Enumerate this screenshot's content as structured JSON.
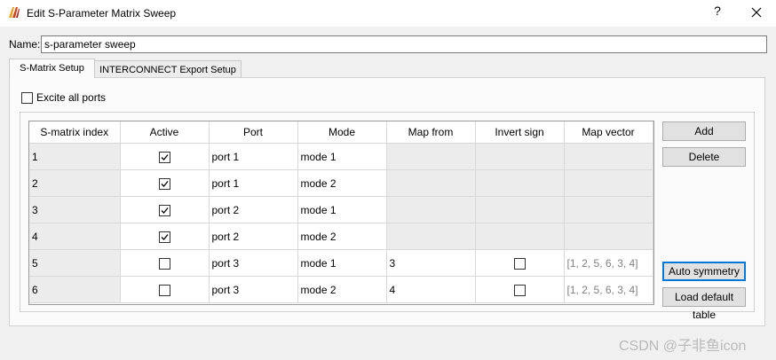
{
  "window": {
    "title": "Edit S-Parameter Matrix Sweep",
    "help_label": "?",
    "app_icon": "lumerical-logo-icon",
    "close_icon": "close-icon"
  },
  "name_field": {
    "label": "Name:",
    "value": "s-parameter sweep"
  },
  "tabs": [
    {
      "label": "S-Matrix Setup",
      "active": true
    },
    {
      "label": "INTERCONNECT Export Setup",
      "active": false
    }
  ],
  "excite_all_ports": {
    "label": "Excite all ports",
    "checked": false
  },
  "table": {
    "columns": [
      "S-matrix index",
      "Active",
      "Port",
      "Mode",
      "Map from",
      "Invert sign",
      "Map vector"
    ],
    "rows": [
      {
        "index": "1",
        "active": true,
        "port": "port 1",
        "mode": "mode 1",
        "map_from": "",
        "invert": null,
        "map_vector": ""
      },
      {
        "index": "2",
        "active": true,
        "port": "port 1",
        "mode": "mode 2",
        "map_from": "",
        "invert": null,
        "map_vector": ""
      },
      {
        "index": "3",
        "active": true,
        "port": "port 2",
        "mode": "mode 1",
        "map_from": "",
        "invert": null,
        "map_vector": ""
      },
      {
        "index": "4",
        "active": true,
        "port": "port 2",
        "mode": "mode 2",
        "map_from": "",
        "invert": null,
        "map_vector": ""
      },
      {
        "index": "5",
        "active": false,
        "port": "port 3",
        "mode": "mode 1",
        "map_from": "3",
        "invert": false,
        "map_vector": "[1, 2, 5, 6, 3, 4]"
      },
      {
        "index": "6",
        "active": false,
        "port": "port 3",
        "mode": "mode 2",
        "map_from": "4",
        "invert": false,
        "map_vector": "[1, 2, 5, 6, 3, 4]"
      }
    ]
  },
  "side_buttons": {
    "add": "Add",
    "delete": "Delete",
    "auto_symmetry": "Auto symmetry",
    "load_default": "Load default table"
  },
  "footer": {
    "watermark": "CSDN @子非鱼icon"
  },
  "colors": {
    "focus": "#0078d7",
    "grey_cell": "#ececec",
    "vector_text": "#808080"
  }
}
